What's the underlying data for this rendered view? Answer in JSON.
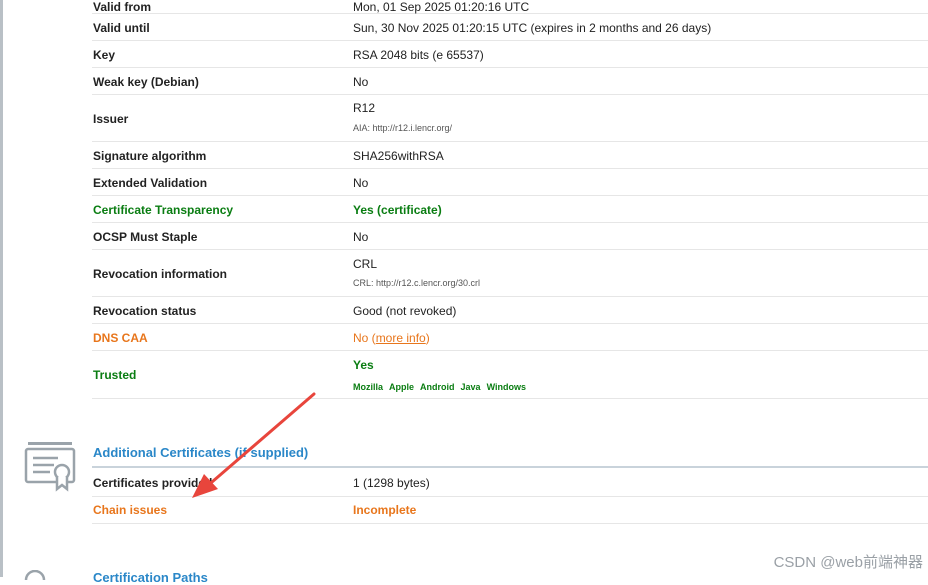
{
  "cert_rows": [
    {
      "label": "Valid from",
      "value": "Mon, 01 Sep 2025 01:20:16 UTC"
    },
    {
      "label": "Valid until",
      "value": "Sun, 30 Nov 2025 01:20:15 UTC (expires in 2 months and 26 days)"
    },
    {
      "label": "Key",
      "value": "RSA 2048 bits (e 65537)"
    },
    {
      "label": "Weak key (Debian)",
      "value": "No"
    },
    {
      "label": "Issuer",
      "value": "R12",
      "sub": "AIA: http://r12.i.lencr.org/"
    },
    {
      "label": "Signature algorithm",
      "value": "SHA256withRSA"
    },
    {
      "label": "Extended Validation",
      "value": "No"
    },
    {
      "label": "Certificate Transparency",
      "value": "Yes (certificate)"
    },
    {
      "label": "OCSP Must Staple",
      "value": "No"
    },
    {
      "label": "Revocation information",
      "value": "CRL",
      "sub": "CRL: http://r12.c.lencr.org/30.crl"
    },
    {
      "label": "Revocation status",
      "value": "Good (not revoked)"
    },
    {
      "label": "DNS CAA",
      "value": "No",
      "link": "more info",
      "paren_open": " (",
      "paren_close": ")"
    },
    {
      "label": "Trusted",
      "value": "Yes",
      "browsers": [
        "Mozilla",
        "Apple",
        "Android",
        "Java",
        "Windows"
      ]
    }
  ],
  "additional": {
    "title": "Additional Certificates (if supplied)",
    "rows": [
      {
        "label": "Certificates provided",
        "value": "1 (1298 bytes)"
      },
      {
        "label": "Chain issues",
        "value": "Incomplete"
      }
    ]
  },
  "next_section_title": "Certification Paths",
  "colors": {
    "green": "#0a7d12",
    "orange": "#e8761c",
    "link_blue": "#2a87c8",
    "arrow": "#e8453c"
  },
  "watermark": "CSDN @web前端神器"
}
